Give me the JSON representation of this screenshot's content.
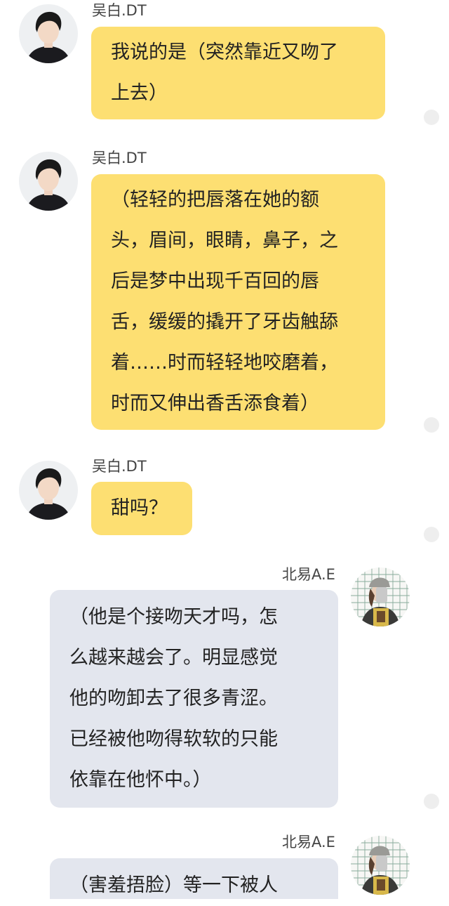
{
  "messages": [
    {
      "sender": "吴白.DT",
      "side": "left",
      "lines": [
        "我说的是（突然靠近又吻了",
        "上去）"
      ]
    },
    {
      "sender": "吴白.DT",
      "side": "left",
      "lines": [
        "（轻轻的把唇落在她的额",
        "头，眉间，眼睛，鼻子，之",
        "后是梦中出现千百回的唇",
        "舌，缓缓的撬开了牙齿触舔",
        "着……时而轻轻地咬磨着，",
        "时而又伸出香舌添食着）"
      ]
    },
    {
      "sender": "吴白.DT",
      "side": "left",
      "lines": [
        "甜吗？"
      ]
    },
    {
      "sender": "北易A.E",
      "side": "right",
      "lines": [
        "（他是个接吻天才吗，怎",
        "么越来越会了。明显感觉",
        "他的吻卸去了很多青涩。",
        "已经被他吻得软软的只能",
        "依靠在他怀中。）"
      ]
    },
    {
      "sender": "北易A.E",
      "side": "right",
      "lines": [
        "（害羞捂脸）等一下被人"
      ]
    }
  ],
  "colors": {
    "left_bubble": "#fddf72",
    "right_bubble": "#e3e6ee",
    "status_dot": "#eeeeee"
  }
}
